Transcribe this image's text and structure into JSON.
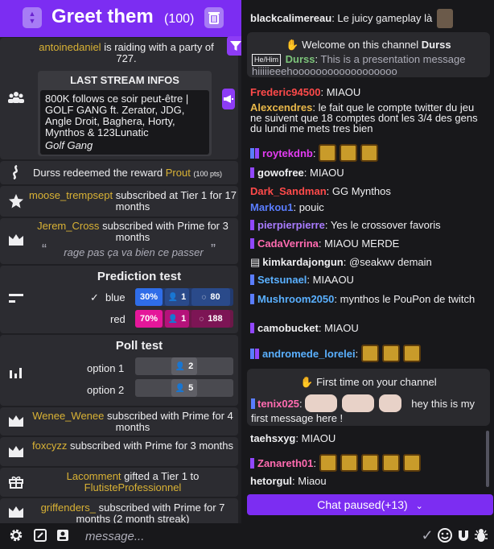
{
  "colors": {
    "accent": "#7c2df2",
    "gold": "#d9b235",
    "blue": "#2f6de8",
    "pink": "#e5179a"
  },
  "header": {
    "title": "Greet them",
    "count": "(100)"
  },
  "events": {
    "raid": {
      "user": "antoinedaniel",
      "text": "is raiding with a party of 727."
    },
    "stream_infos": {
      "title": "LAST STREAM INFOS",
      "body": "800K follows ce soir peut-être | GOLF GANG ft. Zerator, JDG, Angle Droit, Baghera, Horty, Mynthos & 123Lunatic",
      "game": "Golf Gang"
    },
    "redeem": {
      "text": "Durss redeemed the reward",
      "reward": "Prout",
      "pts": "(100 pts)"
    },
    "sub1": {
      "user": "moose_trempsept",
      "text": "subscribed at Tier 1 for 17 months"
    },
    "sub2": {
      "user": "Jerem_Cross",
      "text": "subscribed with Prime for 3 months",
      "quote": "rage pas ça va bien ce passer"
    },
    "prediction": {
      "title": "Prediction test",
      "outcomes": [
        {
          "label": "blue",
          "winner": true,
          "percent": "30%",
          "users": "1",
          "points": "80",
          "fraction": 0.3
        },
        {
          "label": "red",
          "winner": false,
          "percent": "70%",
          "users": "1",
          "points": "188",
          "fraction": 0.7
        }
      ]
    },
    "poll": {
      "title": "Poll test",
      "choices": [
        {
          "label": "option 1",
          "votes": "2"
        },
        {
          "label": "option 2",
          "votes": "5"
        }
      ]
    },
    "sub3": {
      "user": "Wenee_Wenee",
      "text": "subscribed with Prime for 4 months"
    },
    "sub4": {
      "user": "foxcyzz",
      "text": "subscribed with Prime for 3 months"
    },
    "gift": {
      "user": "Lacomment",
      "text": "gifted a Tier 1 to",
      "recipient": "FlutisteProfessionnel"
    },
    "sub5": {
      "user": "griffenders_",
      "text": "subscribed with Prime for 7 months (2 month streak)"
    }
  },
  "chat": {
    "m0": {
      "user": "blackcalimereau",
      "text": "Le juicy gameplay là"
    },
    "welcome": {
      "title": "Welcome on this channel",
      "channel": "Durss",
      "pronoun": "He/Him",
      "user": "Durss",
      "text": "This is a presentation message hiiiiieeehoooooooooooooooooo"
    },
    "m1": {
      "user": "Frederic94500",
      "text": "MIAOU"
    },
    "m2": {
      "user": "Alexcendres",
      "text": "le fait que le compte twitter du jeu ne suivent que 18 comptes dont les 3/4 des gens du lundi me mets tres bien"
    },
    "m3": {
      "user": "roytekdnb",
      "text": ""
    },
    "m4": {
      "user": "gowofree",
      "text": "MIAOU"
    },
    "m5": {
      "user": "Dark_Sandman",
      "text": "GG Mynthos"
    },
    "m6": {
      "user": "Markou1",
      "text": "pouic"
    },
    "m7": {
      "user": "pierpierpierre",
      "text": "Yes le crossover favoris"
    },
    "m8": {
      "user": "CadaVerrina",
      "text": "MIAOU MERDE"
    },
    "m9": {
      "user": "kimkardajongun",
      "text": "@seakwv demain"
    },
    "m10": {
      "user": "Setsunael",
      "text": "MIAAOU"
    },
    "m11": {
      "user": "Mushroom2050",
      "text": "mynthos le PouPon de twitch"
    },
    "m12": {
      "user": "camobucket",
      "text": "MIAOU"
    },
    "m13": {
      "user": "andromede_lorelei",
      "text": ""
    },
    "first": {
      "title": "First time on your channel",
      "user": "tenix025",
      "text": "hey this is my first message here !"
    },
    "m14": {
      "user": "taehsxyg",
      "text": "MIAOU"
    },
    "m15": {
      "user": "Zanareth01",
      "text": ""
    },
    "m16": {
      "user": "hetorgul",
      "text": "Miaou"
    },
    "paused": "Chat paused(+13)"
  },
  "input": {
    "placeholder": "message..."
  }
}
